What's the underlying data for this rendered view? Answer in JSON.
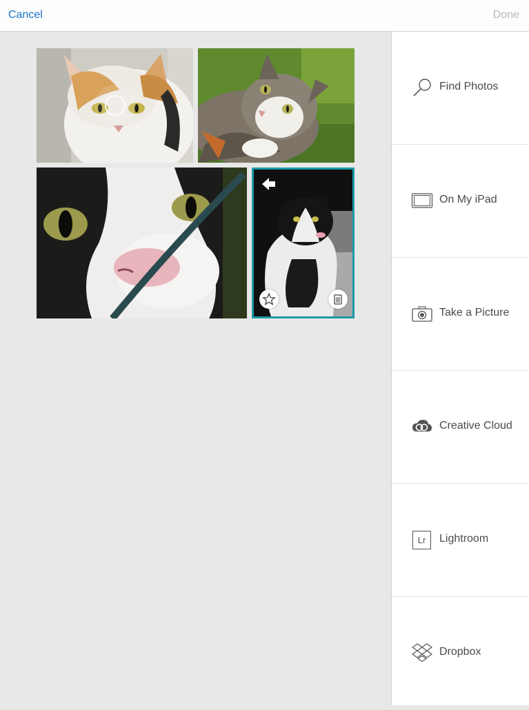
{
  "topbar": {
    "cancel_label": "Cancel",
    "done_label": "Done"
  },
  "collage": {
    "photos": [
      {
        "subject": "calico cat"
      },
      {
        "subject": "tabby cat lying in grass"
      },
      {
        "subject": "black and white cat close-up"
      },
      {
        "subject": "black and white cat sitting",
        "selected": true
      }
    ],
    "selected_frame_color": "#1b9aa7"
  },
  "sidebar": {
    "items": [
      {
        "label": "Find Photos",
        "icon": "magnifier-icon"
      },
      {
        "label": "On My iPad",
        "icon": "ipad-icon"
      },
      {
        "label": "Take a Picture",
        "icon": "camera-icon"
      },
      {
        "label": "Creative Cloud",
        "icon": "creative-cloud-icon"
      },
      {
        "label": "Lightroom",
        "icon": "lightroom-icon"
      },
      {
        "label": "Dropbox",
        "icon": "dropbox-icon"
      }
    ],
    "lightroom_icon_text": "Lr"
  }
}
